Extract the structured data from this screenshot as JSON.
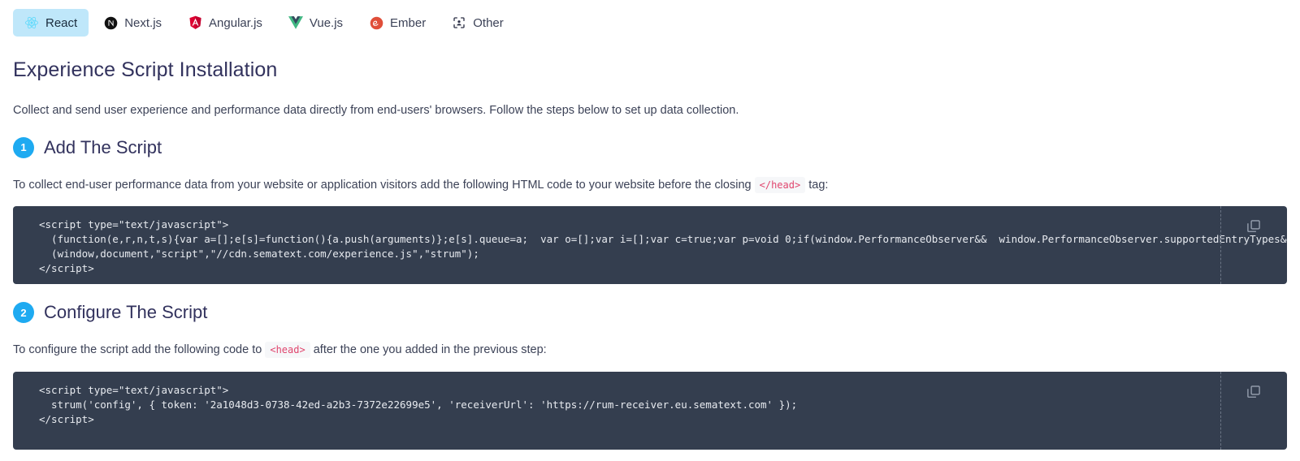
{
  "tabs": [
    {
      "label": "React",
      "icon": "react-icon",
      "active": true
    },
    {
      "label": "Next.js",
      "icon": "nextjs-icon",
      "active": false
    },
    {
      "label": "Angular.js",
      "icon": "angular-icon",
      "active": false
    },
    {
      "label": "Vue.js",
      "icon": "vue-icon",
      "active": false
    },
    {
      "label": "Ember",
      "icon": "ember-icon",
      "active": false
    },
    {
      "label": "Other",
      "icon": "other-icon",
      "active": false
    }
  ],
  "page": {
    "title": "Experience Script Installation",
    "intro": "Collect and send user experience and performance data directly from end-users' browsers. Follow the steps below to set up data collection."
  },
  "step1": {
    "number": "1",
    "title": "Add The Script",
    "desc_before": "To collect end-user performance data from your website or application visitors add the following HTML code to your website before the closing",
    "inline_tag": "</head>",
    "desc_after": "tag:",
    "code": "<script type=\"text/javascript\">\n  (function(e,r,n,t,s){var a=[];e[s]=function(){a.push(arguments)};e[s].queue=a;  var o=[];var i=[];var c=true;var p=void 0;if(window.PerformanceObserver&&  window.PerformanceObserver.supportedEntryTypes&&(  PerformanceObserver.s\n  (window,document,\"script\",\"//cdn.sematext.com/experience.js\",\"strum\");\n</script>",
    "copy_label": "copy-icon"
  },
  "step2": {
    "number": "2",
    "title": "Configure The Script",
    "desc_before": "To configure the script add the following code to",
    "inline_tag": "<head>",
    "desc_after": "after the one you added in the previous step:",
    "code": "<script type=\"text/javascript\">\n  strum('config', { token: '2a1048d3-0738-42ed-a2b3-7372e22699e5', 'receiverUrl': 'https://rum-receiver.eu.sematext.com' });\n</script>",
    "copy_label": "copy-icon"
  },
  "colors": {
    "accent": "#1eaaf1",
    "tab_active_bg": "#bfe7fa",
    "code_bg": "#343e4f",
    "inline_tag_fg": "#e0466e",
    "text": "#32325d"
  }
}
